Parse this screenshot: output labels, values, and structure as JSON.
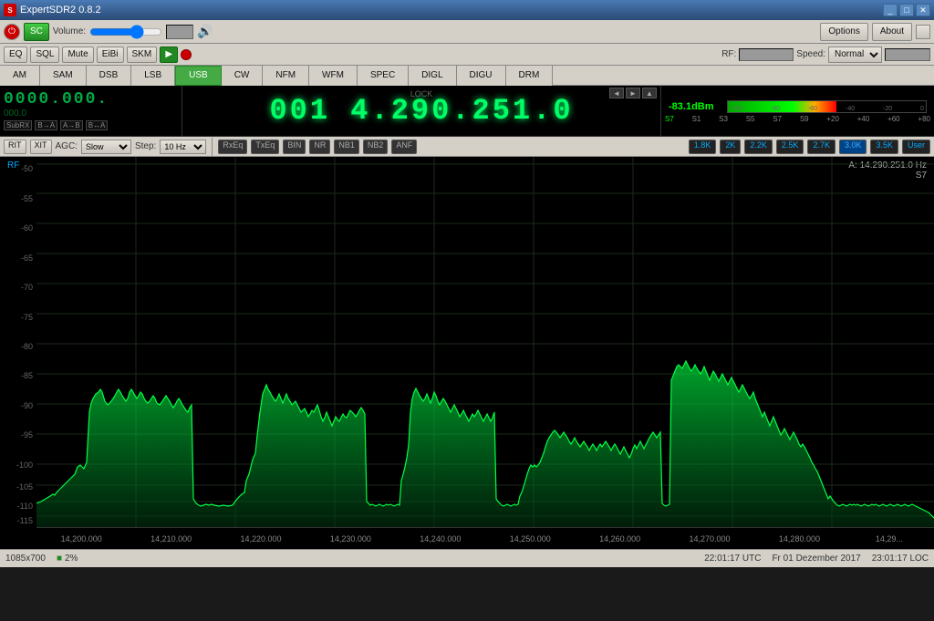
{
  "titlebar": {
    "title": "ExpertSDR2 0.8.2",
    "win_buttons": [
      "_",
      "□",
      "✕"
    ]
  },
  "toolbar1": {
    "power_btn": "⏻",
    "sc_btn": "SC",
    "volume_label": "Volume:",
    "options_btn": "Options",
    "about_btn": "About"
  },
  "toolbar2": {
    "eq_btn": "EQ",
    "sql_btn": "SQL",
    "mute_btn": "Mute",
    "eibi_btn": "EiBi",
    "skm_btn": "SKM",
    "rf_label": "RF:",
    "speed_label": "Speed:"
  },
  "modebar": {
    "modes": [
      "AM",
      "SAM",
      "DSB",
      "LSB",
      "USB",
      "CW",
      "NFM",
      "WFM",
      "SPEC",
      "DIGL",
      "DIGU",
      "DRM"
    ],
    "active": "USB"
  },
  "frequency": {
    "main": "014.290.251.0",
    "display": "001 4.290.251.0",
    "smeter_dbm": "-83.1dBm",
    "smeter_label": "S7",
    "info_line1": "A: 14.290.251.0 Hz",
    "info_line2": "S7"
  },
  "ctrlbar": {
    "rit_label": "RIT",
    "xit_label": "XIT",
    "agc_label": "AGC:",
    "agc_value": "Slow",
    "step_label": "Step:",
    "step_value": "10 Hz",
    "rxeq_btn": "RxEq",
    "txeq_btn": "TxEq",
    "bin_btn": "BIN",
    "nr_btn": "NR",
    "nb1_btn": "NB1",
    "nb2_btn": "NB2",
    "anf_btn": "ANF",
    "bw_buttons": [
      "1.8K",
      "2K",
      "2.2K",
      "2.5K",
      "2.7K",
      "3.0K",
      "3.5K",
      "User"
    ],
    "active_bw": "3.0K"
  },
  "spectrum": {
    "db_scale": [
      "-50",
      "-55",
      "-60",
      "-65",
      "-70",
      "-75",
      "-80",
      "-85",
      "-90",
      "-95",
      "-100",
      "-105",
      "-110",
      "-115"
    ],
    "freq_scale": [
      "14,200.000",
      "14,210.000",
      "14,220.000",
      "14,230.000",
      "14,240.000",
      "14,250.000",
      "14,260.000",
      "14,270.000",
      "14,280.000",
      "14,29..."
    ],
    "rf_label": "RF",
    "info_freq": "A: 14.290.251.0 Hz",
    "info_smeter": "S7"
  },
  "statusbar": {
    "resolution": "1085x700",
    "cpu": "2%",
    "time_utc": "22:01:17 UTC",
    "date": "Fr 01 Dezember 2017",
    "time_loc": "23:01:17 LOC"
  },
  "smeter": {
    "scale_neg": [
      "-100",
      "-80",
      "-60",
      "-40",
      "-20",
      "0"
    ],
    "scale_s": [
      "S7",
      "S1",
      "S3",
      "S5",
      "S7",
      "S9",
      "+20",
      "+40",
      "+60",
      "+80"
    ]
  }
}
